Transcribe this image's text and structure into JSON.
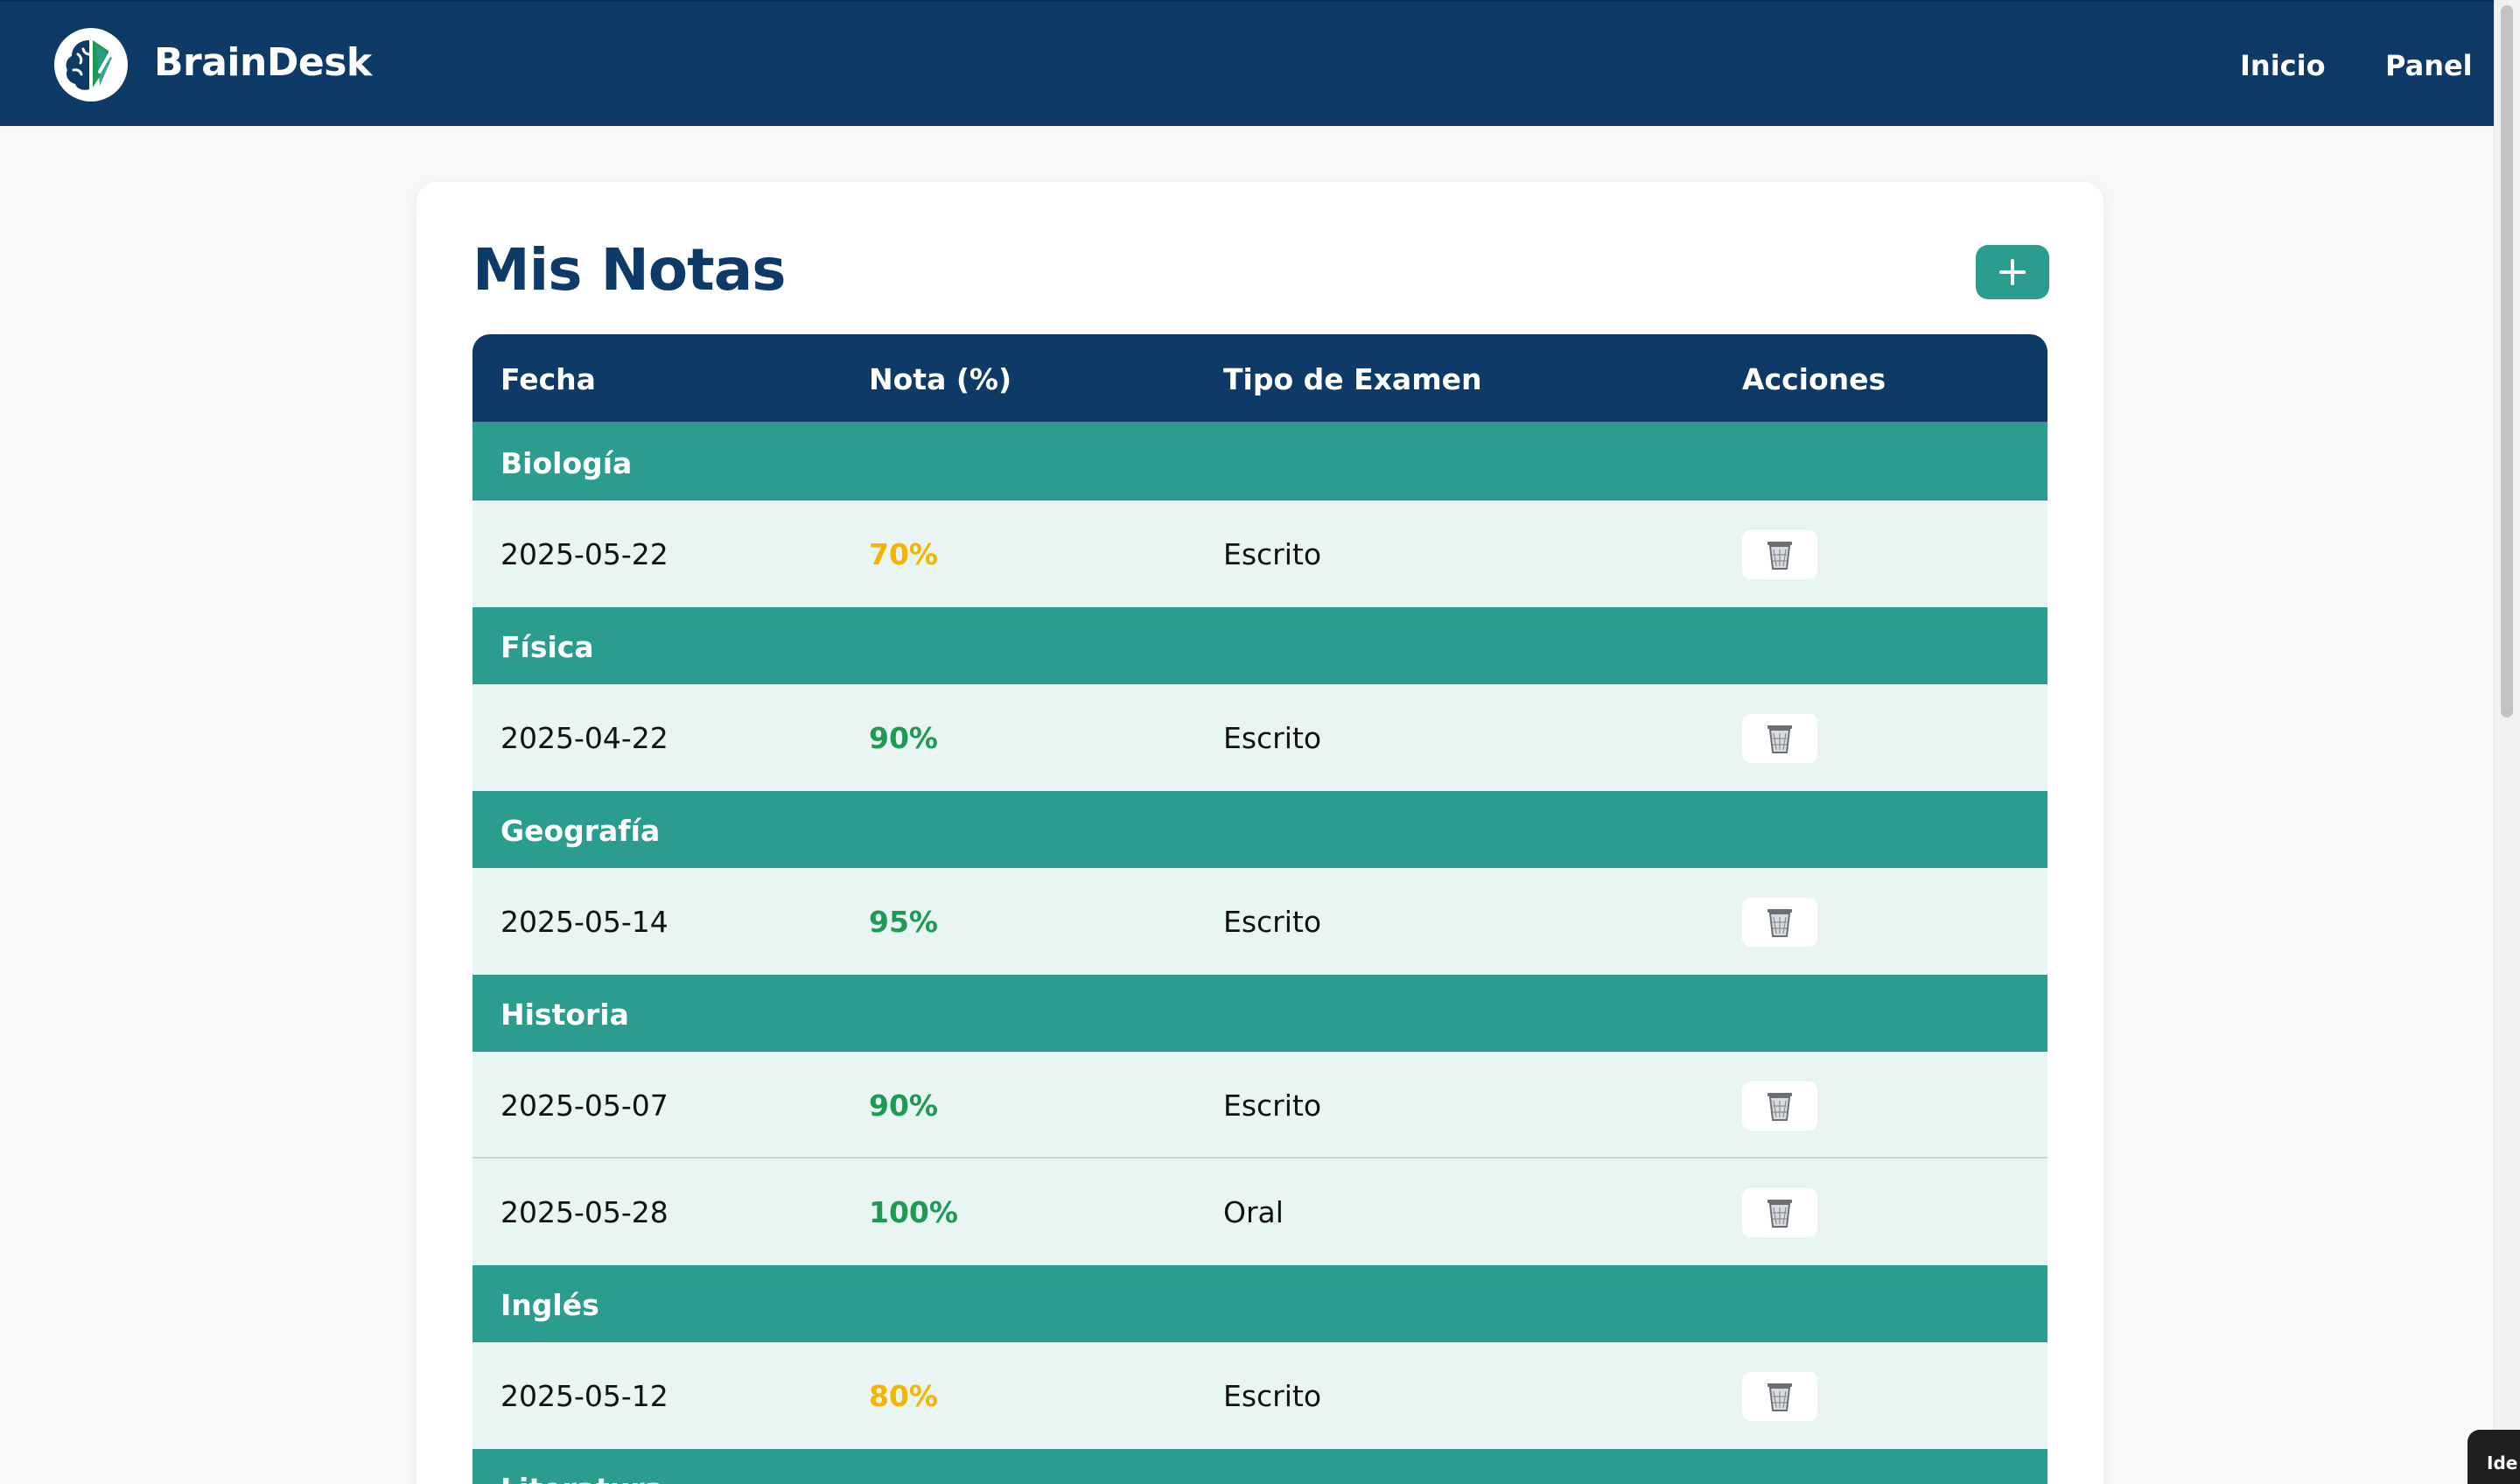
{
  "header": {
    "brand": "BrainDesk",
    "logo_icon": "brain-icon",
    "nav": [
      {
        "label": "Inicio"
      },
      {
        "label": "Panel"
      }
    ]
  },
  "main": {
    "title": "Mis Notas",
    "add_button_icon": "plus-icon",
    "table": {
      "headers": [
        "Fecha",
        "Nota (%)",
        "Tipo de Examen",
        "Acciones"
      ],
      "groups": [
        {
          "subject": "Biología",
          "rows": [
            {
              "date": "2025-05-22",
              "grade": "70%",
              "grade_color": "#f4b400",
              "type": "Escrito"
            }
          ]
        },
        {
          "subject": "Física",
          "rows": [
            {
              "date": "2025-04-22",
              "grade": "90%",
              "grade_color": "#1f9a55",
              "type": "Escrito"
            }
          ]
        },
        {
          "subject": "Geografía",
          "rows": [
            {
              "date": "2025-05-14",
              "grade": "95%",
              "grade_color": "#1f9a55",
              "type": "Escrito"
            }
          ]
        },
        {
          "subject": "Historia",
          "rows": [
            {
              "date": "2025-05-07",
              "grade": "90%",
              "grade_color": "#1f9a55",
              "type": "Escrito"
            },
            {
              "date": "2025-05-28",
              "grade": "100%",
              "grade_color": "#1f9a55",
              "type": "Oral"
            }
          ]
        },
        {
          "subject": "Inglés",
          "rows": [
            {
              "date": "2025-05-12",
              "grade": "80%",
              "grade_color": "#f4b400",
              "type": "Escrito"
            }
          ]
        },
        {
          "subject": "Literatura",
          "rows": []
        }
      ],
      "action_icon": "trash-icon"
    }
  },
  "corner_widget": {
    "text": "Ide"
  },
  "colors": {
    "navy": "#0d3a66",
    "teal": "#2a9d8f",
    "row_bg": "#e8f5f2",
    "grade_green": "#1f9a55",
    "grade_yellow": "#f4b400"
  }
}
